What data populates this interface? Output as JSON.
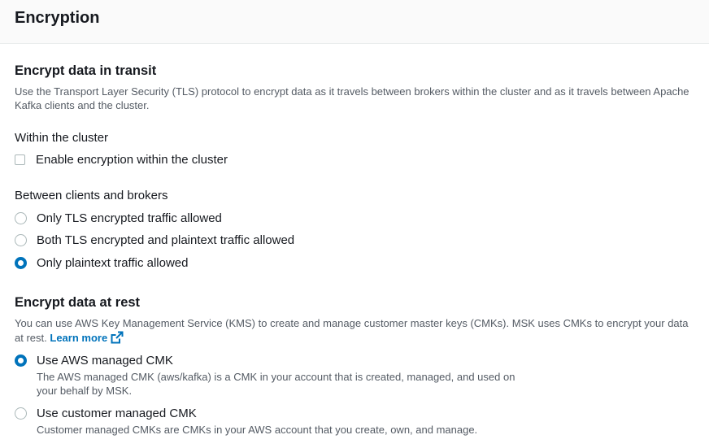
{
  "header": {
    "title": "Encryption"
  },
  "transit": {
    "title": "Encrypt data in transit",
    "description": "Use the Transport Layer Security (TLS) protocol to encrypt data as it travels between brokers within the cluster and as it travels between Apache Kafka clients and the cluster.",
    "within_cluster": {
      "label": "Within the cluster",
      "checkbox_label": "Enable encryption within the cluster",
      "checked": false
    },
    "between": {
      "label": "Between clients and brokers",
      "options": [
        {
          "label": "Only TLS encrypted traffic allowed",
          "selected": false
        },
        {
          "label": "Both TLS encrypted and plaintext traffic allowed",
          "selected": false
        },
        {
          "label": "Only plaintext traffic allowed",
          "selected": true
        }
      ]
    }
  },
  "rest": {
    "title": "Encrypt data at rest",
    "description": "You can use AWS Key Management Service (KMS) to create and manage customer master keys (CMKs). MSK uses CMKs to encrypt your data at rest.",
    "learn_more": "Learn more",
    "options": [
      {
        "label": "Use AWS managed CMK",
        "description": "The AWS managed CMK (aws/kafka) is a CMK in your account that is created, managed, and used on your behalf by MSK.",
        "selected": true
      },
      {
        "label": "Use customer managed CMK",
        "description": "Customer managed CMKs are CMKs in your AWS account that you create, own, and manage.",
        "selected": false
      }
    ]
  },
  "colors": {
    "accent": "#0073bb",
    "text": "#16191f",
    "secondary_text": "#545b64"
  },
  "icons": {
    "external_link": "external-link-icon"
  }
}
